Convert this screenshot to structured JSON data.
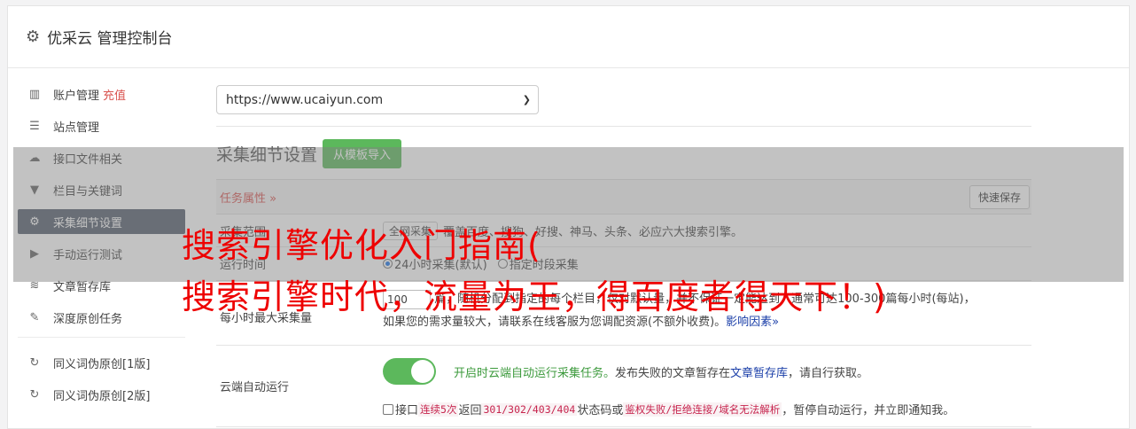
{
  "header": {
    "title": "优采云 管理控制台",
    "icon": "gear-icon"
  },
  "sidebar": {
    "items": [
      {
        "label": "账户管理",
        "icon": "bar-chart-icon",
        "extra": "充值"
      },
      {
        "label": "站点管理",
        "icon": "server-icon"
      },
      {
        "label": "接口文件相关",
        "icon": "cloud-upload-icon"
      },
      {
        "label": "栏目与关键词",
        "icon": "filter-icon"
      },
      {
        "label": "采集细节设置",
        "icon": "cogs-icon"
      },
      {
        "label": "手动运行测试",
        "icon": "play-circle-icon"
      },
      {
        "label": "文章暂存库",
        "icon": "database-icon"
      },
      {
        "label": "深度原创任务",
        "icon": "edit-icon"
      },
      {
        "label": "同义词伪原创[1版]",
        "icon": "refresh-icon"
      },
      {
        "label": "同义词伪原创[2版]",
        "icon": "refresh-icon"
      }
    ]
  },
  "main": {
    "site_select": "https://www.ucaiyun.com",
    "section_title": "采集细节设置",
    "import_button": "从模板导入",
    "task_attr": "任务属性 »",
    "quick_save": "快速保存",
    "scope": {
      "label": "采集范围",
      "select": "全网采集",
      "desc": "覆盖百度、搜狗、好搜、神马、头条、必应六大搜索引擎。"
    },
    "run_time": {
      "label": "运行时间",
      "opt1": "24小时采集(默认)",
      "opt2": "指定时段采集"
    },
    "max": {
      "label": "每小时最大采集量",
      "value": "100",
      "text1": "篇，随机分配到指定的每个栏目，仅对默认量，并不保证一定能达到，通常可达100-300篇每小时(每站)，",
      "text2": "如果您的需求量较大，请联系在线客服为您调配资源(不额外收费)。",
      "link": "影响因素»"
    },
    "cloud": {
      "label": "云端自动运行",
      "desc_green": "开启时云端自动运行采集任务。",
      "desc_plain": "发布失败的文章暂存在",
      "desc_link": "文章暂存库",
      "desc_tail": "，请自行获取。",
      "cb_label": "接口",
      "code1": "连续5次",
      "text_a": "返回",
      "code2": "301/302/403/404",
      "text_b": "状态码或",
      "code3": "鉴权失败/拒绝连接/域名无法解析",
      "text_c": "，暂停自动运行，并立即通知我。"
    }
  },
  "overlay_headline": {
    "line1": "搜索引擎优化入门指南(",
    "line2": "搜索引擎时代，流量为王，得百度者得天下！)"
  }
}
